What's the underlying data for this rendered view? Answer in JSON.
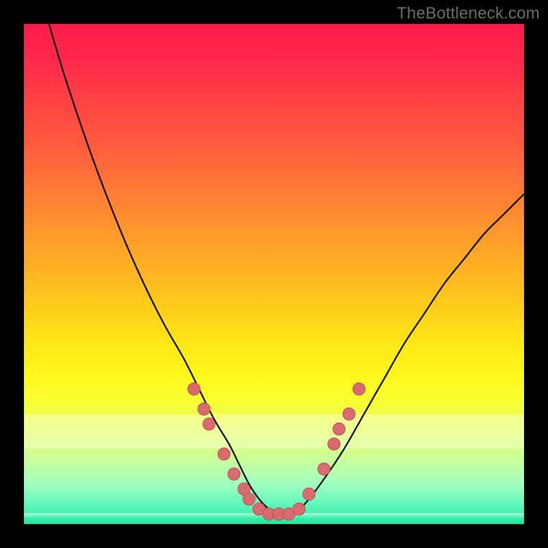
{
  "watermark": "TheBottleneck.com",
  "colors": {
    "background": "#000000",
    "curve": "#000000",
    "dot_fill": "#d76b6f",
    "dot_stroke": "#b74e52",
    "grad_top": "#ff1a4a",
    "grad_bottom": "#22e8a0"
  },
  "chart_data": {
    "type": "line",
    "title": "",
    "xlabel": "",
    "ylabel": "",
    "xlim": [
      0,
      100
    ],
    "ylim": [
      0,
      100
    ],
    "series": [
      {
        "name": "curve",
        "x": [
          5,
          8,
          12,
          16,
          20,
          24,
          28,
          32,
          35,
          38,
          41,
          43,
          45,
          47,
          49,
          51,
          53,
          55,
          57,
          60,
          64,
          68,
          72,
          76,
          80,
          84,
          88,
          92,
          96,
          100
        ],
        "y": [
          100,
          90,
          78,
          67,
          57,
          48,
          40,
          33,
          27,
          21,
          16,
          12,
          8,
          5,
          3,
          2,
          2,
          3,
          5,
          9,
          15,
          22,
          29,
          36,
          42,
          48,
          53,
          58,
          62,
          66
        ]
      }
    ],
    "markers": [
      {
        "x": 34,
        "y": 27
      },
      {
        "x": 36,
        "y": 23
      },
      {
        "x": 37,
        "y": 20
      },
      {
        "x": 40,
        "y": 14
      },
      {
        "x": 42,
        "y": 10
      },
      {
        "x": 44,
        "y": 7
      },
      {
        "x": 45,
        "y": 5
      },
      {
        "x": 47,
        "y": 3
      },
      {
        "x": 49,
        "y": 2
      },
      {
        "x": 51,
        "y": 2
      },
      {
        "x": 53,
        "y": 2
      },
      {
        "x": 55,
        "y": 3
      },
      {
        "x": 57,
        "y": 6
      },
      {
        "x": 60,
        "y": 11
      },
      {
        "x": 62,
        "y": 16
      },
      {
        "x": 63,
        "y": 19
      },
      {
        "x": 65,
        "y": 22
      },
      {
        "x": 67,
        "y": 27
      }
    ]
  }
}
